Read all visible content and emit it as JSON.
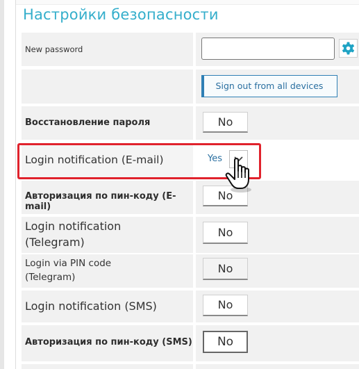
{
  "section_title": "Настройки безопасности",
  "rows": {
    "new_password": {
      "label": "New password",
      "value": ""
    },
    "sign_out": {
      "button_label": "Sign out from all devices"
    },
    "password_recovery": {
      "label": "Восстановление пароля",
      "value": "No"
    },
    "login_notification_email": {
      "label": "Login notification (E-mail)",
      "value": "Yes"
    },
    "pin_auth_email": {
      "label": "Авторизация по пин-коду (E-mail)",
      "value": "No"
    },
    "login_notification_telegram": {
      "label_line1": "Login notification",
      "label_line2": "(Telegram)",
      "value": "No"
    },
    "login_pin_telegram": {
      "label_line1": "Login via PIN code",
      "label_line2": "(Telegram)",
      "value": "No"
    },
    "login_notification_sms": {
      "label": "Login notification (SMS)",
      "value": "No"
    },
    "pin_auth_sms": {
      "label": "Авторизация по пин-коду (SMS)",
      "value": "No"
    }
  },
  "icons": {
    "settings": "gear-icon",
    "dropdown": "chevron-down-icon",
    "cursor": "hand-pointer-icon"
  },
  "colors": {
    "title": "#34aecb",
    "highlight": "#e0222c",
    "gear": "#1fa3c4",
    "selected_value": "#2a6fa0"
  }
}
